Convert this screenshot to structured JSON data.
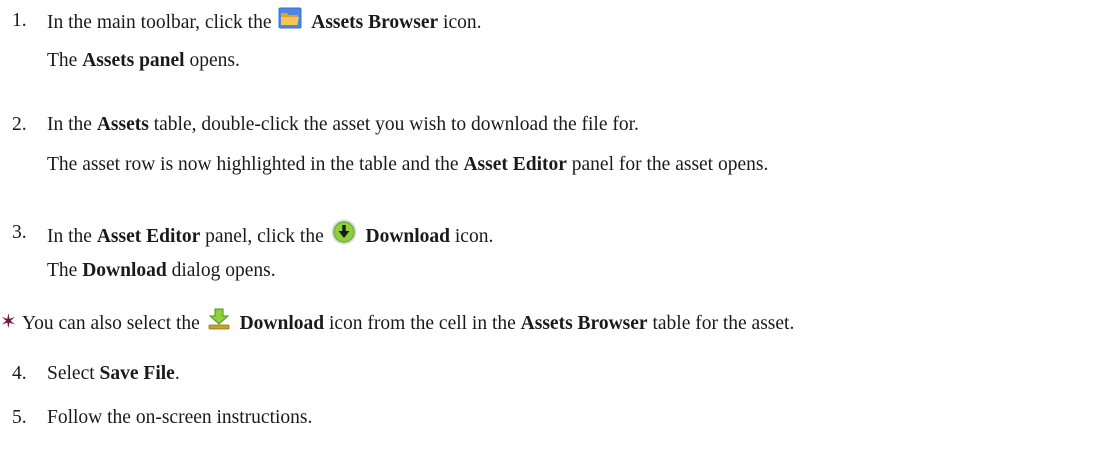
{
  "steps": [
    {
      "num": "1.",
      "before": "In the main toolbar, click the",
      "icon": "folder-icon",
      "bold": "Assets Browser",
      "after": "icon.",
      "result_bold": "Assets panel",
      "result_after": "opens."
    },
    {
      "num": "2.",
      "before": "In the",
      "bold": "Assets",
      "after": "table, double-click the asset you wish to download the file for.",
      "result_before": "The asset row is now highlighted in the table and the",
      "result_bold": "Asset Editor",
      "result_after": "panel for the asset opens."
    },
    {
      "num": "3.",
      "before": "In the",
      "bold": "Asset Editor",
      "mid": "panel, click the",
      "icon": "download-circle-icon",
      "bold2": "Download",
      "after": "icon.",
      "result_before": "The",
      "result_bold": "Download",
      "result_after": "dialog opens."
    },
    {
      "num": "4.",
      "before": "Select",
      "bold": "Save File",
      "after": "."
    },
    {
      "num": "5.",
      "text": "Follow the on-screen instructions."
    }
  ],
  "note": {
    "icon": "star-icon",
    "before": "You can also select the",
    "glyph": "download-arrow-icon",
    "bold": "Download",
    "mid": "icon from the cell in the",
    "bold2": "Assets Browser",
    "after": "table for the asset."
  },
  "colors": {
    "star": "#6e1a3e",
    "folder": "#f2b73a",
    "download_green": "#8fd13d",
    "text": "#1a1a1a"
  }
}
